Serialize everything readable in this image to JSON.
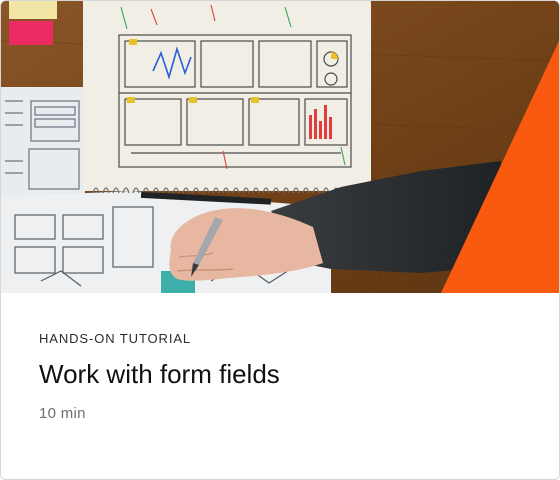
{
  "card": {
    "eyebrow": "HANDS-ON TUTORIAL",
    "title": "Work with form fields",
    "duration": "10 min"
  },
  "colors": {
    "accent_orange": "#fa5a0f",
    "wood": "#7a4a1f",
    "paper": "#f1eee6",
    "sleeve": "#2e3133",
    "skin": "#e8b7a2"
  },
  "image": {
    "subject": "hands-sketching-wireframes-photo"
  }
}
